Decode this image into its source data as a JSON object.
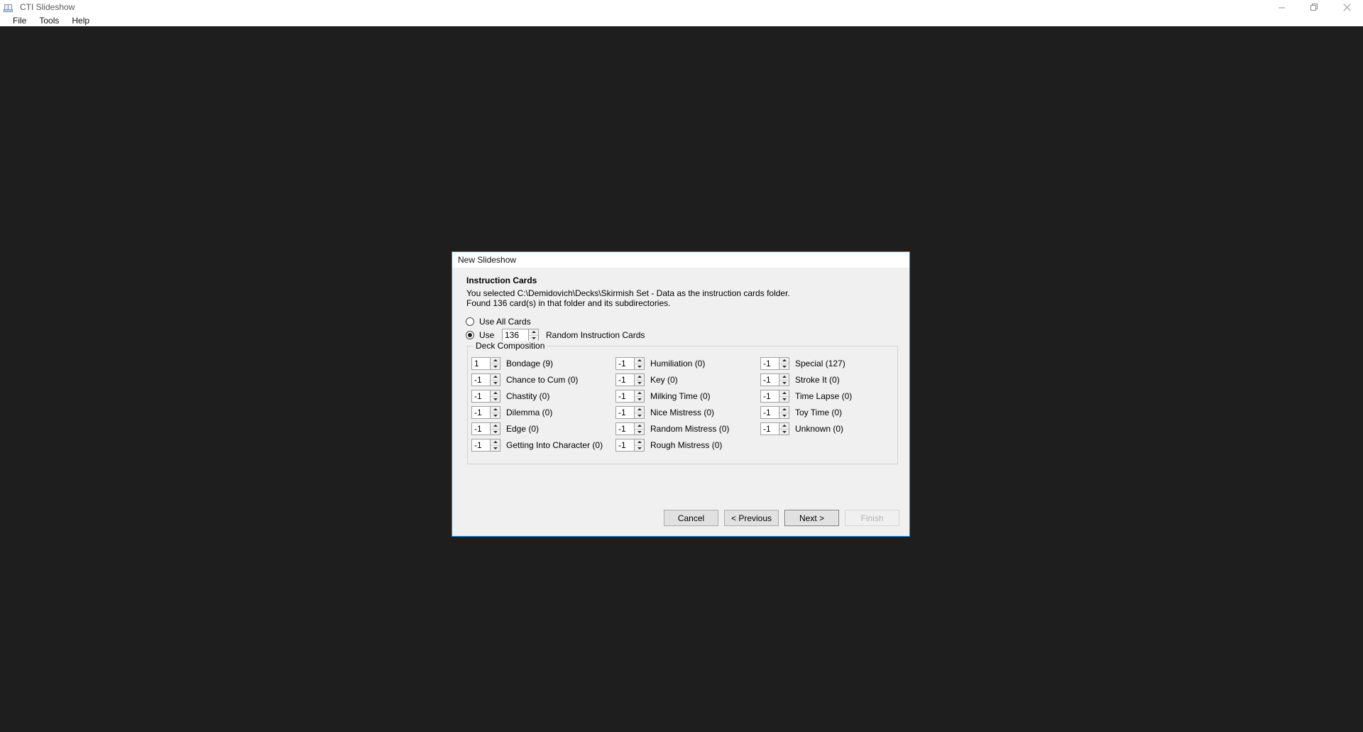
{
  "window": {
    "title": "CTI Slideshow",
    "icon": "app-slideshow-icon",
    "controls": {
      "minimize": "minimize-icon",
      "restore": "restore-icon",
      "close": "close-icon"
    }
  },
  "menu": {
    "items": [
      {
        "label": "File"
      },
      {
        "label": "Tools"
      },
      {
        "label": "Help"
      }
    ]
  },
  "dialog": {
    "title": "New Slideshow",
    "heading": "Instruction Cards",
    "info_line_1": "You selected C:\\Demidovich\\Decks\\Skirmish Set - Data as the instruction cards folder.",
    "info_line_2": "Found 136 card(s) in that folder and its subdirectories.",
    "options": {
      "use_all_label": "Use All Cards",
      "use_all_selected": false,
      "use_some_label": "Use",
      "use_some_selected": true,
      "use_count_value": "136",
      "random_cards_label": "Random Instruction Cards"
    },
    "deck_composition": {
      "legend": "Deck Composition",
      "columns": [
        [
          {
            "value": "1",
            "label": "Bondage (9)"
          },
          {
            "value": "-1",
            "label": "Chance to Cum (0)"
          },
          {
            "value": "-1",
            "label": "Chastity (0)"
          },
          {
            "value": "-1",
            "label": "Dilemma (0)"
          },
          {
            "value": "-1",
            "label": "Edge (0)"
          },
          {
            "value": "-1",
            "label": "Getting Into Character (0)"
          }
        ],
        [
          {
            "value": "-1",
            "label": "Humiliation (0)"
          },
          {
            "value": "-1",
            "label": "Key (0)"
          },
          {
            "value": "-1",
            "label": "Milking Time (0)"
          },
          {
            "value": "-1",
            "label": "Nice Mistress (0)"
          },
          {
            "value": "-1",
            "label": "Random Mistress (0)"
          },
          {
            "value": "-1",
            "label": "Rough Mistress (0)"
          }
        ],
        [
          {
            "value": "-1",
            "label": "Special (127)"
          },
          {
            "value": "-1",
            "label": "Stroke It (0)"
          },
          {
            "value": "-1",
            "label": "Time Lapse (0)"
          },
          {
            "value": "-1",
            "label": "Toy Time (0)"
          },
          {
            "value": "-1",
            "label": "Unknown (0)"
          }
        ]
      ]
    },
    "buttons": [
      {
        "label": "Cancel",
        "state": "normal"
      },
      {
        "label": "< Previous",
        "state": "normal"
      },
      {
        "label": "Next >",
        "state": "primary"
      },
      {
        "label": "Finish",
        "state": "disabled"
      }
    ],
    "border_color": "#1883d7"
  },
  "colors": {
    "desktop": "#1e1e1e",
    "dialog_face": "#f0f0f0",
    "accent": "#1883d7"
  }
}
